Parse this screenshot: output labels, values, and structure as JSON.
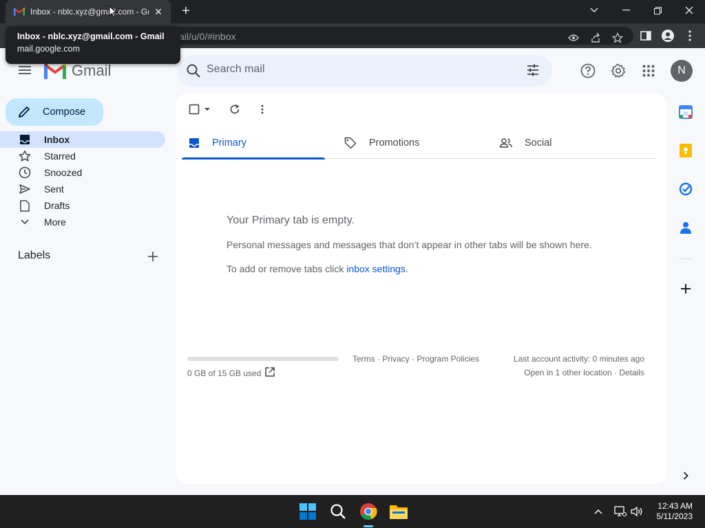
{
  "browser": {
    "tab_title": "Inbox - nblc.xyz@gmail.com - Gmail",
    "tab_title_visible": "Inbox - nblc.xyz@gmail.com - Gr",
    "url_visible": "ail/u/0/#inbox",
    "tooltip": {
      "title": "Inbox - nblc.xyz@gmail.com - Gmail",
      "url": "mail.google.com"
    }
  },
  "header": {
    "logo_text": "Gmail",
    "search_placeholder": "Search mail",
    "avatar_initial": "N"
  },
  "sidebar": {
    "compose_label": "Compose",
    "items": [
      {
        "label": "Inbox",
        "icon": "inbox-icon",
        "active": true
      },
      {
        "label": "Starred",
        "icon": "star-icon"
      },
      {
        "label": "Snoozed",
        "icon": "clock-icon"
      },
      {
        "label": "Sent",
        "icon": "send-icon"
      },
      {
        "label": "Drafts",
        "icon": "draft-icon"
      },
      {
        "label": "More",
        "icon": "chevron-down-icon"
      }
    ],
    "labels_title": "Labels"
  },
  "main": {
    "tabs": [
      {
        "label": "Primary",
        "icon": "inbox-icon",
        "active": true
      },
      {
        "label": "Promotions",
        "icon": "tag-icon"
      },
      {
        "label": "Social",
        "icon": "people-icon"
      }
    ],
    "empty_title": "Your Primary tab is empty.",
    "empty_desc": "Personal messages and messages that don’t appear in other tabs will be shown here.",
    "empty_hint_prefix": "To add or remove tabs click ",
    "empty_hint_link": "inbox settings",
    "empty_hint_suffix": ".",
    "storage_text": "0 GB of 15 GB used",
    "storage_used_fraction": 0.0,
    "footer_links": "Terms · Privacy · Program Policies",
    "last_activity": "Last account activity: 0 minutes ago",
    "other_location": "Open in 1 other location · Details"
  },
  "side_panel": {
    "calendar_day": "31"
  },
  "taskbar": {
    "time": "12:43 AM",
    "date": "5/11/2023"
  },
  "colors": {
    "accent": "#0b57d0",
    "compose_bg": "#c2e7ff",
    "active_nav_bg": "#d3e3fd",
    "search_bg": "#eaf1fb",
    "page_bg": "#f6f8fc"
  }
}
